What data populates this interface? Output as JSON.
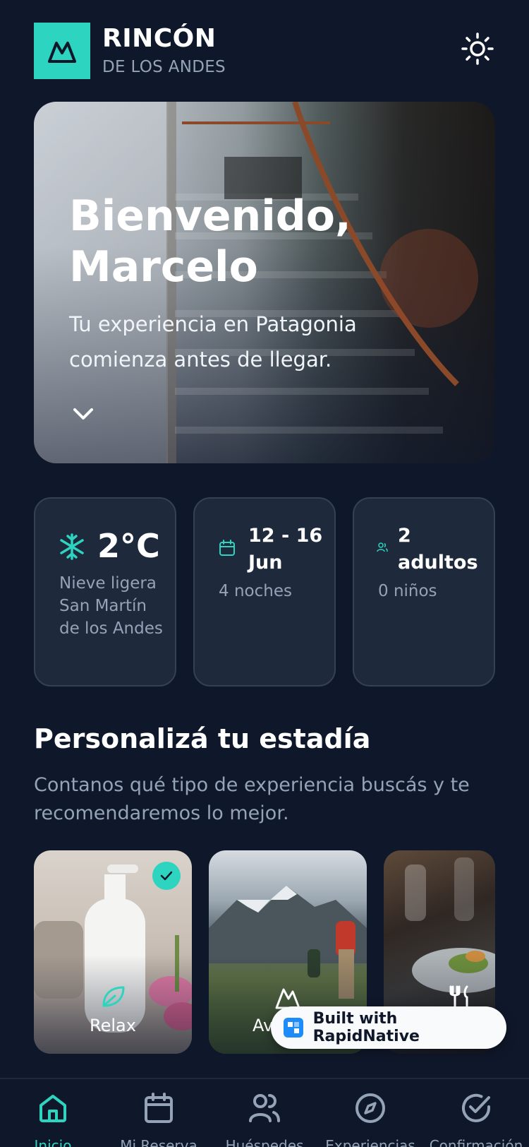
{
  "header": {
    "brand_title": "RINCÓN",
    "brand_subtitle": "DE LOS ANDES",
    "logo_icon": "mountain-icon",
    "theme_icon": "sun-icon"
  },
  "hero": {
    "title": "Bienvenido, Marcelo",
    "subtitle": "Tu experiencia en Patagonia comienza antes de llegar.",
    "chevron_icon": "chevron-down-icon"
  },
  "info_cards": {
    "weather": {
      "icon": "snowflake-icon",
      "temperature": "2°C",
      "description": "Nieve ligera San Martín de los Andes"
    },
    "dates": {
      "icon": "calendar-icon",
      "range": "12 - 16 Jun",
      "nights": "4 noches"
    },
    "guests": {
      "icon": "users-icon",
      "adults": "2 adultos",
      "children": "0 niños"
    }
  },
  "personalize": {
    "title": "Personalizá tu estadía",
    "description": "Contanos qué tipo de experiencia buscás y te recomendaremos lo mejor.",
    "experiences": [
      {
        "label": "Relax",
        "icon": "leaf-icon",
        "selected": true
      },
      {
        "label": "Av",
        "icon": "mountain-icon",
        "selected": false
      },
      {
        "label": "",
        "icon": "fork-knife-icon",
        "selected": false
      }
    ]
  },
  "built_with": {
    "label": "Built with RapidNative"
  },
  "bottom_nav": {
    "items": [
      {
        "label": "Inicio",
        "icon": "home-icon",
        "active": true
      },
      {
        "label": "Mi Reserva",
        "icon": "calendar-icon",
        "active": false
      },
      {
        "label": "Huéspedes",
        "icon": "users-icon",
        "active": false
      },
      {
        "label": "Experiencias",
        "icon": "compass-icon",
        "active": false
      },
      {
        "label": "Confirmación",
        "icon": "check-circle-icon",
        "active": false
      }
    ]
  },
  "colors": {
    "background": "#0f172a",
    "card": "#1e293b",
    "accent": "#2dd4bf",
    "muted_text": "#94a3b8"
  }
}
